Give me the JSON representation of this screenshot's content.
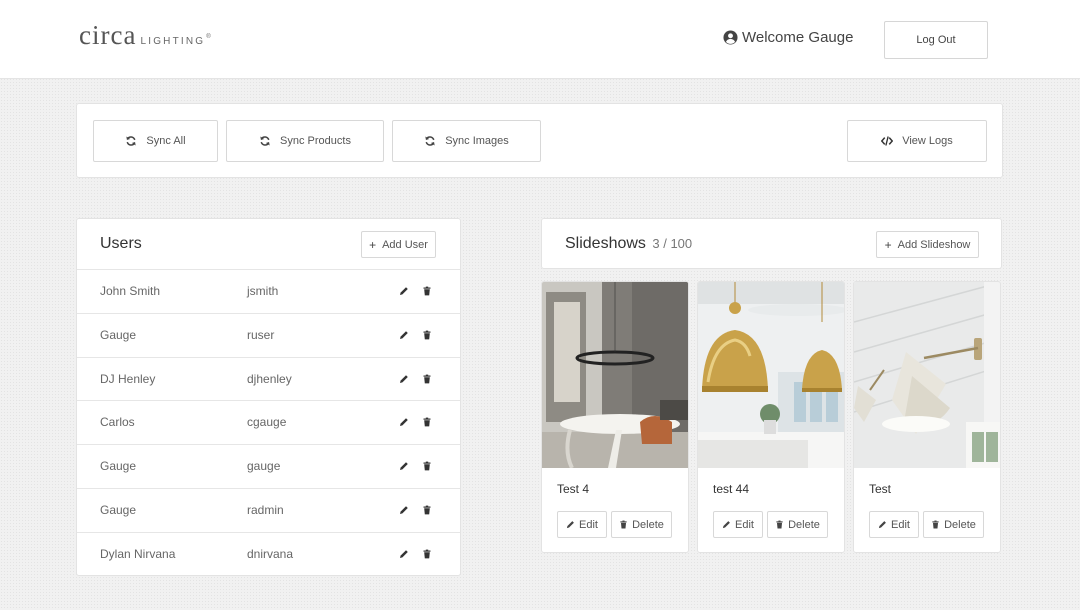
{
  "header": {
    "logo_main": "circa",
    "logo_sub": "LIGHTING",
    "logo_reg": "®",
    "welcome_text": "Welcome Gauge",
    "logout_label": "Log Out"
  },
  "sync": {
    "sync_all": "Sync All",
    "sync_products": "Sync Products",
    "sync_images": "Sync Images",
    "view_logs": "View Logs"
  },
  "users": {
    "title": "Users",
    "add_label": "Add User",
    "rows": [
      {
        "name": "John Smith",
        "login": "jsmith"
      },
      {
        "name": "Gauge",
        "login": "ruser"
      },
      {
        "name": "DJ Henley",
        "login": "djhenley"
      },
      {
        "name": "Carlos",
        "login": "cgauge"
      },
      {
        "name": "Gauge",
        "login": "gauge"
      },
      {
        "name": "Gauge",
        "login": "radmin"
      },
      {
        "name": "Dylan Nirvana",
        "login": "dnirvana"
      }
    ]
  },
  "slideshows": {
    "title": "Slideshows",
    "count": "3 / 100",
    "add_label": "Add Slideshow",
    "cards": [
      {
        "title": "Test 4",
        "edit_label": "Edit",
        "delete_label": "Delete"
      },
      {
        "title": "test 44",
        "edit_label": "Edit",
        "delete_label": "Delete"
      },
      {
        "title": "Test",
        "edit_label": "Edit",
        "delete_label": "Delete"
      }
    ]
  },
  "icons": {
    "user": "user-circle-icon",
    "sync": "refresh-icon",
    "logs": "code-icon",
    "add": "plus-icon",
    "edit": "pencil-icon",
    "delete": "trash-icon"
  },
  "colors": {
    "background": "#f1f1f1",
    "panel": "#ffffff",
    "border": "#e3e3e3",
    "text": "#333333",
    "muted_text": "#666666",
    "brass": "#c9a24a"
  }
}
